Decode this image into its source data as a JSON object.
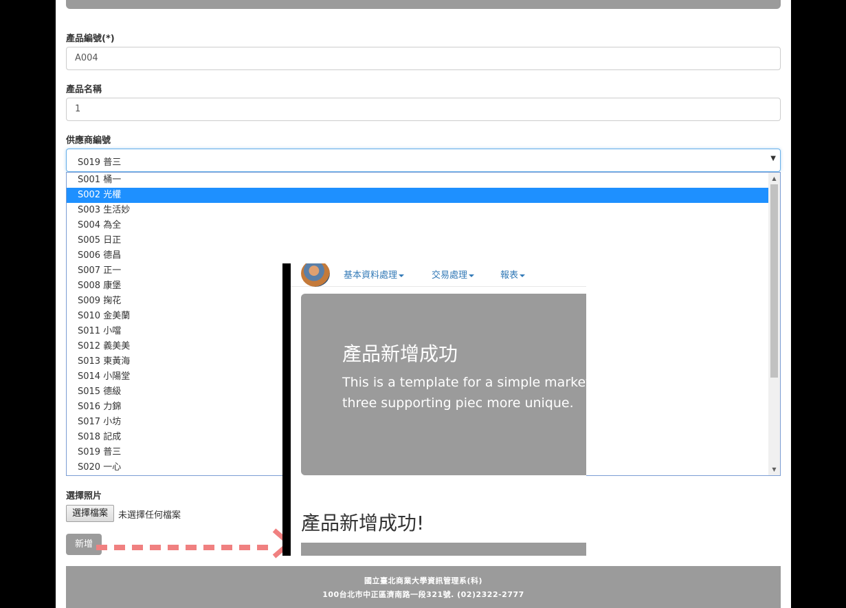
{
  "form": {
    "product_id_label": "產品編號(*)",
    "product_id_value": "A004",
    "product_name_label": "產品名稱",
    "product_name_value": "1",
    "supplier_label": "供應商編號",
    "supplier_selected": "S019 普三",
    "supplier_options": [
      "S001 桶一",
      "S002 光權",
      "S003 生活妙",
      "S004 為全",
      "S005 日正",
      "S006 德昌",
      "S007 正一",
      "S008 康堡",
      "S009 掬花",
      "S010 金美蘭",
      "S011 小噹",
      "S012 義美美",
      "S013 東黃海",
      "S014 小陽堂",
      "S015 德級",
      "S016 力錦",
      "S017 小坊",
      "S018 記成",
      "S019 普三",
      "S020 一心"
    ],
    "highlighted_option": "S002 光權",
    "photo_label": "選擇照片",
    "file_button": "選擇檔案",
    "file_status": "未選擇任何檔案",
    "submit_label": "新增"
  },
  "footer": {
    "line1": "國立臺北商業大學資訊管理系(科)",
    "line2": "100台北市中正區濟南路一段321號. (02)2322-2777"
  },
  "overlay": {
    "nav": {
      "item1": "基本資料處理",
      "item2": "交易處理",
      "item3": "報表"
    },
    "hero_title": "產品新增成功",
    "hero_text": "This is a template for a simple marketi the hero unit and three supporting piec more unique.",
    "success_message": "產品新增成功!"
  },
  "colors": {
    "accent": "#1e90ff",
    "gray_panel": "#9b9b9b",
    "arrow": "#f08080",
    "link": "#337ab7"
  }
}
